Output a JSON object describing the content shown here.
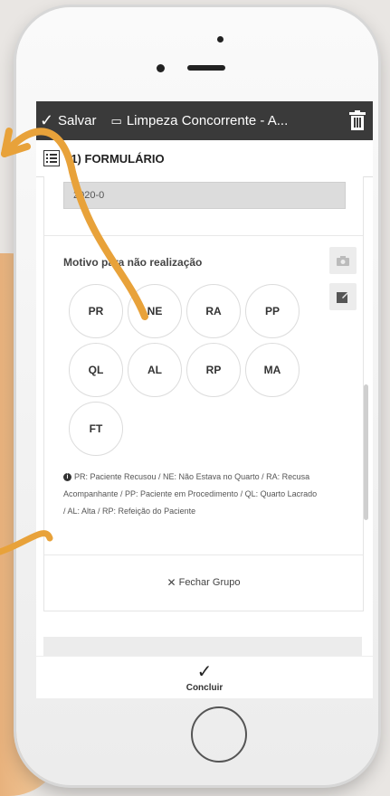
{
  "toolbar": {
    "save_label": "Salvar",
    "title": "Limpeza Concorrente - A..."
  },
  "form_header": {
    "label": "(1) FORMULÁRIO"
  },
  "date_field": {
    "value": "2020-0"
  },
  "reason": {
    "title": "Motivo para não realização",
    "options": [
      "PR",
      "NE",
      "RA",
      "PP",
      "QL",
      "AL",
      "RP",
      "MA",
      "FT"
    ]
  },
  "legend": {
    "text": "PR: Paciente Recusou / NE: Não Estava no Quarto / RA: Recusa Acompanhante / PP: Paciente em Procedimento / QL: Quarto Lacrado / AL: Alta / RP: Refeição do Paciente"
  },
  "close_group": {
    "label": "Fechar Grupo"
  },
  "footer": {
    "conclude_label": "Concluir"
  },
  "colors": {
    "toolbar_bg": "#3a3a3a",
    "accent_arrow": "#e8a23a"
  },
  "icons": {
    "save": "check-icon",
    "title": "clipboard-icon",
    "delete": "trash-icon",
    "form": "list-icon",
    "camera": "camera-icon",
    "edit": "edit-icon",
    "info": "info-icon",
    "close": "close-icon",
    "conclude": "check-icon"
  }
}
